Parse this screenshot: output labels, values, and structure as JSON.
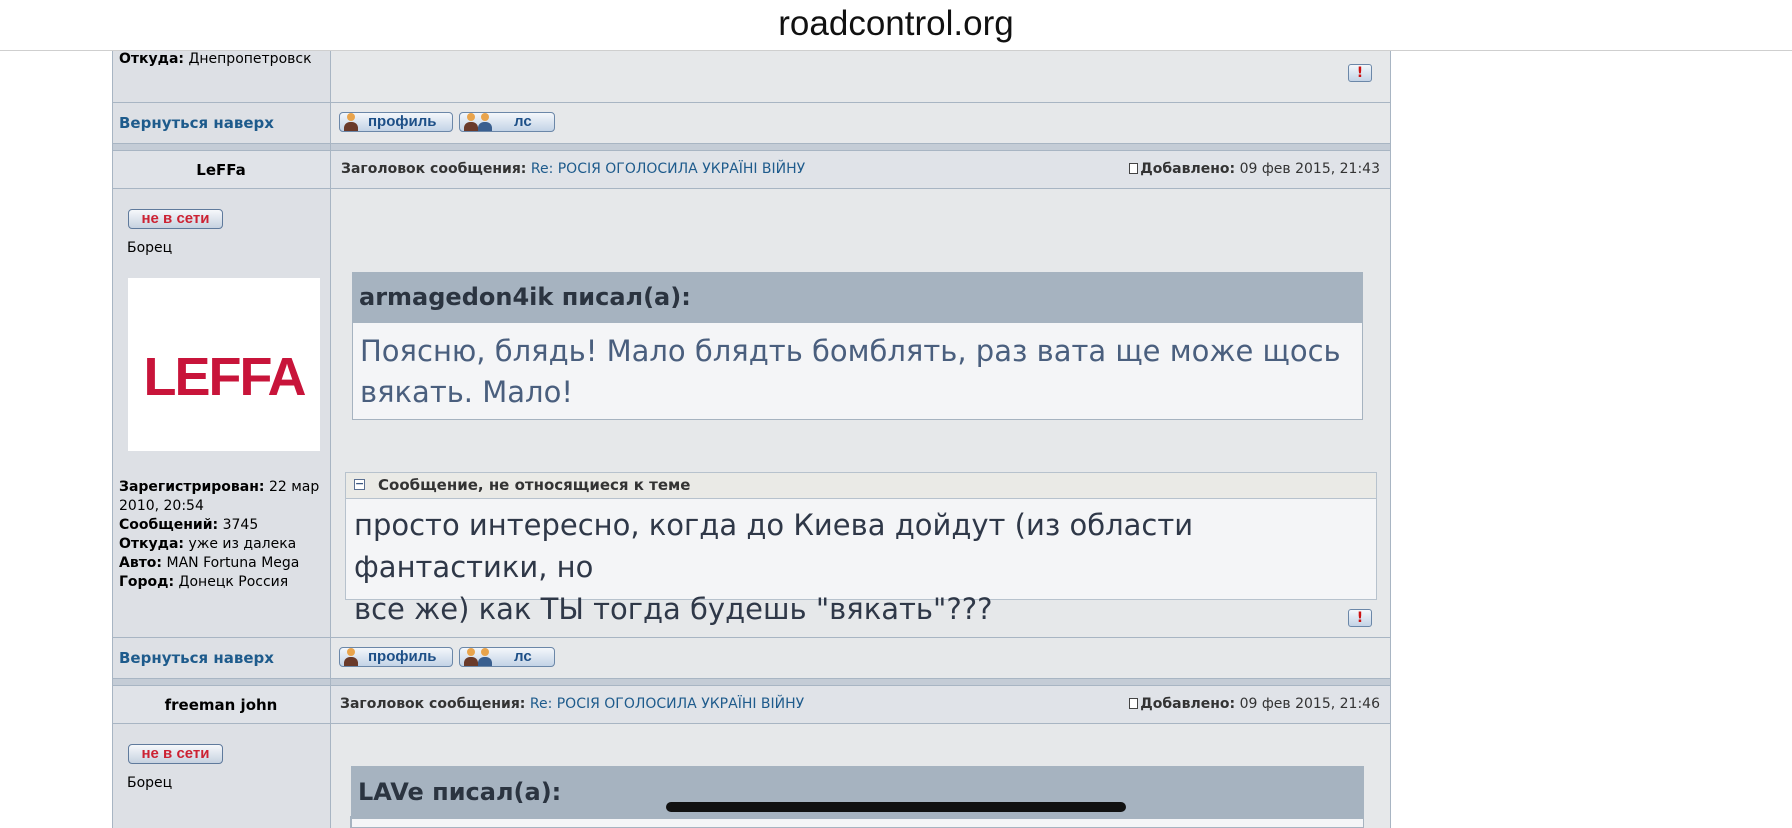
{
  "browser": {
    "url": "roadcontrol.org"
  },
  "common": {
    "back_to_top": "Вернуться наверх",
    "profile_btn": "профиль",
    "pm_btn": "лс",
    "offline_badge": "не в сети",
    "subject_label": "Заголовок сообщения:",
    "added_label": "Добавлено:",
    "report_symbol": "!"
  },
  "prev_post": {
    "from_label": "Откуда:",
    "from_value": "Днепропетровск"
  },
  "post1": {
    "author": "LeFFa",
    "subject": "Re: РОСІЯ ОГОЛОСИЛА УКРАЇНІ ВІЙНУ",
    "date": "09 фев 2015, 21:43",
    "rank": "Борец",
    "avatar_text": "LEFFA",
    "registered_label": "Зарегистрирован:",
    "registered_value": "22 мар",
    "registered_value2": "2010, 20:54",
    "posts_label": "Сообщений:",
    "posts_value": "3745",
    "from_label": "Откуда:",
    "from_value": "уже из далека",
    "car_label": "Авто:",
    "car_value": "MAN Fortuna Mega",
    "city_label": "Город:",
    "city_value": "Донецк Россия",
    "quote_author": "armagedon4ik писал(а):",
    "quote_line1": "Поясню, блядь! Мало блядть бомблять, раз вата ще може щось",
    "quote_line2": "вякать. Мало!",
    "offtopic_title": "Сообщение, не относящиеся к теме",
    "offtopic_line1": "просто интересно, когда до Киева дойдут (из области фантастики, но",
    "offtopic_line2": "все же) как ТЫ тогда будешь \"вякать\"???"
  },
  "post2": {
    "author": "freeman john",
    "subject": "Re: РОСІЯ ОГОЛОСИЛА УКРАЇНІ ВІЙНУ",
    "date": "09 фев 2015, 21:46",
    "rank": "Борец",
    "quote_author": "LAVe писал(а):"
  },
  "colors": {
    "link": "#1e5b8c",
    "quote_header_bg": "#a6b3c0",
    "offline_text": "#cc2233",
    "avatar_logo": "#c8143a"
  }
}
